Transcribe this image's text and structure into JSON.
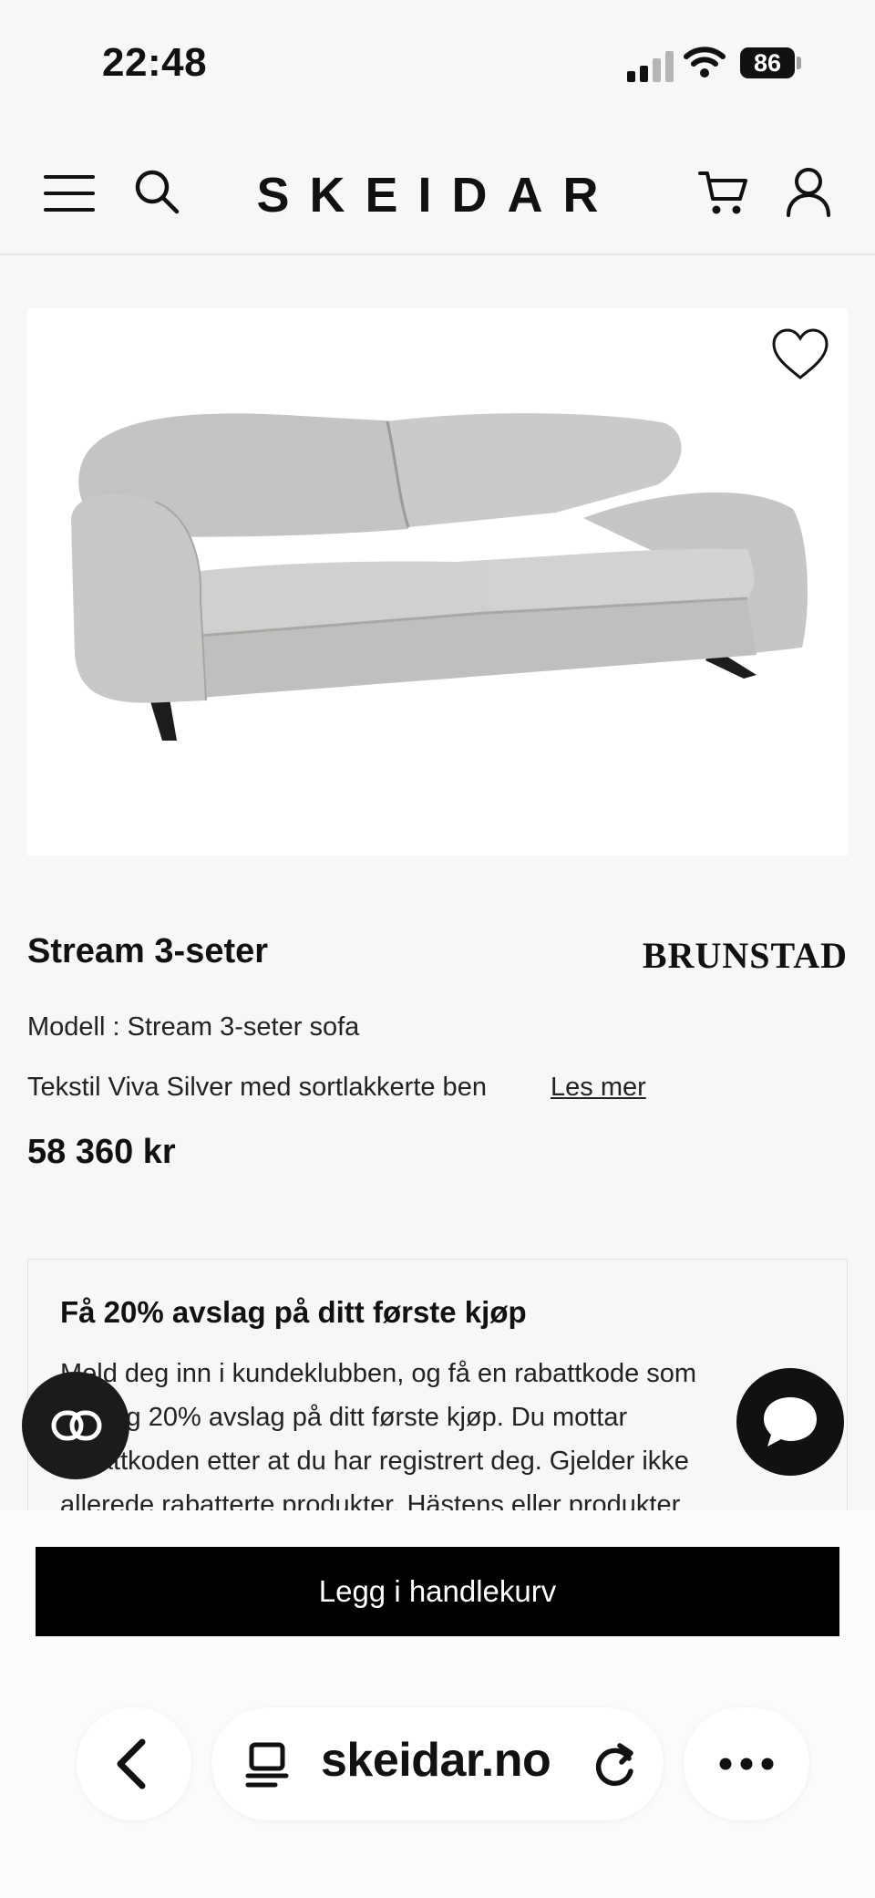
{
  "status_bar": {
    "time": "22:48",
    "battery": "86",
    "icons": [
      "cellular-signal-icon",
      "wifi-icon",
      "battery-icon"
    ]
  },
  "header": {
    "logo": "SKEIDAR",
    "icons": [
      "hamburger-menu-icon",
      "search-icon",
      "cart-icon",
      "user-icon"
    ]
  },
  "product": {
    "title": "Stream 3-seter",
    "brand": "BRUNSTAD",
    "model": "Modell : Stream 3-seter sofa",
    "description": "Tekstil Viva Silver med sortlakkerte ben",
    "read_more": "Les mer",
    "price": "58 360 kr",
    "favorite_icon": "heart-icon"
  },
  "club": {
    "title": "Få 20% avslag på ditt første kjøp",
    "lines": [
      "Meld deg inn i kundeklubben, og få en rabattkode som",
      "gir deg 20% avslag på ditt første kjøp. Du mottar",
      "rabattkoden etter at du har registrert deg. Gjelder ikke",
      "allerede rabatterte produkter, Hästens eller produkter"
    ]
  },
  "floating": {
    "left_icon": "link-icon",
    "right_icon": "chat-bubble-icon"
  },
  "cta": {
    "add_to_cart": "Legg i handlekurv"
  },
  "browser": {
    "url": "skeidar.no",
    "icons": [
      "back-chevron-icon",
      "reader-mode-icon",
      "reload-icon",
      "more-dots-icon"
    ]
  }
}
